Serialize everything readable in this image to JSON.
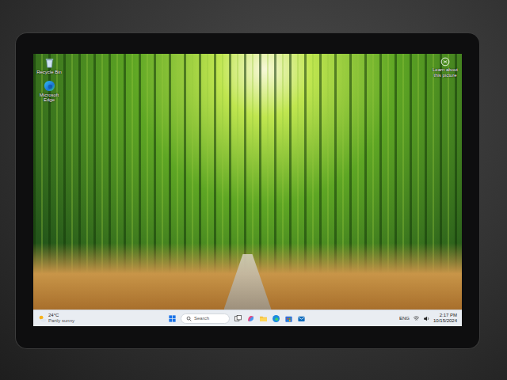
{
  "desktop": {
    "icons": [
      {
        "label": "Recycle Bin",
        "kind": "recycle"
      },
      {
        "label": "Microsoft Edge",
        "kind": "edge"
      }
    ],
    "spotlight": {
      "label": "Learn about this picture"
    }
  },
  "taskbar": {
    "weather": {
      "temp": "24°C",
      "condition": "Partly sunny"
    },
    "search": {
      "placeholder": "Search"
    },
    "pinned": [
      {
        "kind": "taskview"
      },
      {
        "kind": "copilot"
      },
      {
        "kind": "explorer"
      },
      {
        "kind": "edge"
      },
      {
        "kind": "store"
      },
      {
        "kind": "mail"
      }
    ],
    "tray": {
      "language": "ENG",
      "time": "2:17 PM",
      "date": "10/15/2024"
    }
  }
}
